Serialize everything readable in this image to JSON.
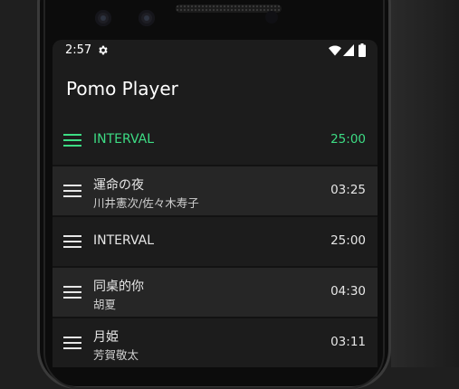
{
  "status_bar": {
    "time": "2:57",
    "icons": [
      "gear-icon",
      "wifi-icon",
      "signal-icon",
      "battery-icon"
    ]
  },
  "app": {
    "title": "Pomo Player"
  },
  "tracks": [
    {
      "title": "INTERVAL",
      "artist": "",
      "duration": "25:00",
      "active": true
    },
    {
      "title": "運命の夜",
      "artist": "川井憲次/佐々木寿子",
      "duration": "03:25",
      "active": false
    },
    {
      "title": "INTERVAL",
      "artist": "",
      "duration": "25:00",
      "active": false
    },
    {
      "title": "同桌的你",
      "artist": "胡夏",
      "duration": "04:30",
      "active": false
    },
    {
      "title": "月姫",
      "artist": "芳賀敬太",
      "duration": "03:11",
      "active": false
    }
  ],
  "colors": {
    "accent": "#3ddc84",
    "row_dark": "#1c1c1c",
    "row_light": "#262626",
    "text": "#e6e6e6"
  }
}
